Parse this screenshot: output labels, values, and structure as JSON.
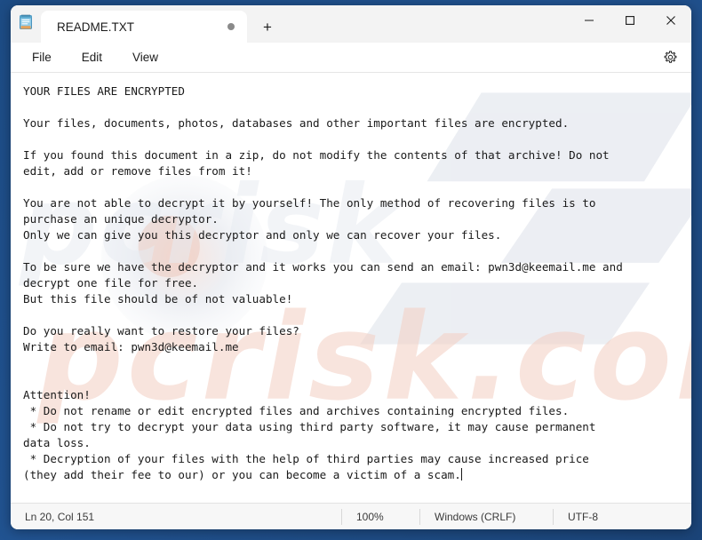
{
  "window": {
    "app_icon": "notepad-icon",
    "controls": {
      "minimize": "minimize-icon",
      "maximize": "maximize-icon",
      "close": "close-icon"
    }
  },
  "tabs": [
    {
      "label": "README.TXT",
      "modified_dot": true
    }
  ],
  "newtab": {
    "label": "+"
  },
  "menu": {
    "items": [
      {
        "label": "File"
      },
      {
        "label": "Edit"
      },
      {
        "label": "View"
      }
    ],
    "settings_icon": "gear-icon"
  },
  "document": {
    "text": "YOUR FILES ARE ENCRYPTED\n\nYour files, documents, photos, databases and other important files are encrypted.\n\nIf you found this document in a zip, do not modify the contents of that archive! Do not\nedit, add or remove files from it!\n\nYou are not able to decrypt it by yourself! The only method of recovering files is to\npurchase an unique decryptor.\nOnly we can give you this decryptor and only we can recover your files.\n\nTo be sure we have the decryptor and it works you can send an email: pwn3d@keemail.me and\ndecrypt one file for free.\nBut this file should be of not valuable!\n\nDo you really want to restore your files?\nWrite to email: pwn3d@keemail.me\n\n\nAttention!\n * Do not rename or edit encrypted files and archives containing encrypted files.\n * Do not try to decrypt your data using third party software, it may cause permanent\ndata loss.\n * Decryption of your files with the help of third parties may cause increased price\n(they add their fee to our) or you can become a victim of a scam."
  },
  "watermark": {
    "text": "pcrisk.com"
  },
  "statusbar": {
    "position": "Ln 20, Col 151",
    "zoom": "100%",
    "line_ending": "Windows (CRLF)",
    "encoding": "UTF-8"
  },
  "colors": {
    "desktop": "#1f4e86",
    "window_bg": "#f3f3f3",
    "editor_bg": "#ffffff",
    "text": "#1a1a1a",
    "status_text": "#3a3a3a"
  }
}
